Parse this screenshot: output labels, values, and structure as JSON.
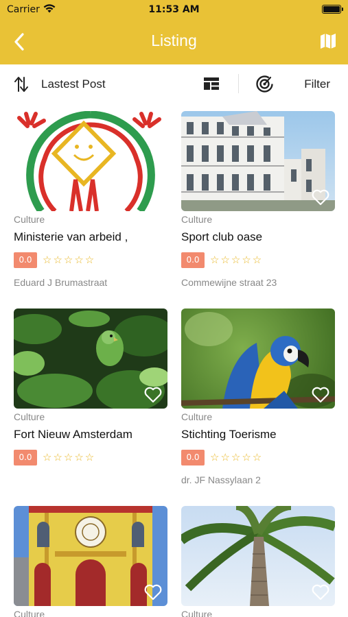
{
  "status_bar": {
    "carrier": "Carrier",
    "time": "11:53 AM"
  },
  "nav": {
    "title": "Listing"
  },
  "toolbar": {
    "sort_label": "Lastest Post",
    "filter_label": "Filter"
  },
  "colors": {
    "header": "#e9c236",
    "rating_badge": "#f28a6e",
    "star": "#e8b623"
  },
  "listings": [
    {
      "category": "Culture",
      "name": "Ministerie van arbeid ,",
      "rating": "0.0",
      "stars": "☆☆☆☆☆",
      "address": "Eduard J Brumastraat",
      "image": "logo-illustration"
    },
    {
      "category": "Culture",
      "name": "Sport club oase",
      "rating": "0.0",
      "stars": "☆☆☆☆☆",
      "address": "Commewijne straat 23",
      "image": "colonial-building"
    },
    {
      "category": "Culture",
      "name": "Fort Nieuw Amsterdam",
      "rating": "0.0",
      "stars": "☆☆☆☆☆",
      "address": "",
      "image": "green-parrot"
    },
    {
      "category": "Culture",
      "name": "Stichting Toerisme",
      "rating": "0.0",
      "stars": "☆☆☆☆☆",
      "address": "dr. JF Nassylaan 2",
      "image": "blue-yellow-macaw"
    },
    {
      "category": "Culture",
      "name": "",
      "rating": "",
      "stars": "",
      "address": "",
      "image": "yellow-cathedral"
    },
    {
      "category": "Culture",
      "name": "",
      "rating": "",
      "stars": "",
      "address": "",
      "image": "palm-tree"
    }
  ]
}
